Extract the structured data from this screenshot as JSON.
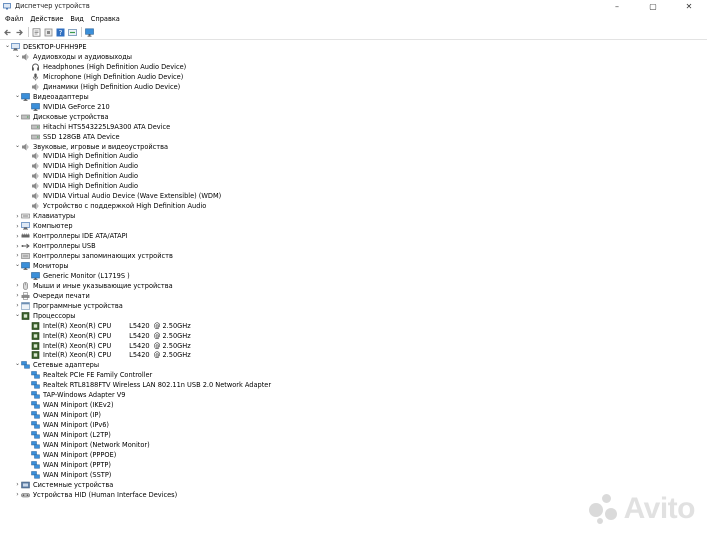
{
  "window": {
    "title": "Диспетчер устройств",
    "controls": [
      "–",
      "▢",
      "✕"
    ]
  },
  "menu": [
    "Файл",
    "Действие",
    "Вид",
    "Справка"
  ],
  "toolbar": [
    "back-icon",
    "forward-icon",
    "properties-icon",
    "update-driver-icon",
    "help-icon",
    "scan-icon",
    "monitor-icon"
  ],
  "tree": {
    "root": "DESKTOP-UFHH9PE",
    "audio": {
      "label": "Аудиовходы и аудиовыходы",
      "items": [
        "Headphones (High Definition Audio Device)",
        "Microphone (High Definition Audio Device)",
        "Динамики (High Definition Audio Device)"
      ]
    },
    "video": {
      "label": "Видеоадаптеры",
      "items": [
        "NVIDIA GeForce 210"
      ]
    },
    "disks": {
      "label": "Дисковые устройства",
      "items": [
        "Hitachi HTS543225L9A300 ATA Device",
        "SSD 128GB ATA Device"
      ]
    },
    "sound": {
      "label": "Звуковые, игровые и видеоустройства",
      "items": [
        "NVIDIA High Definition Audio",
        "NVIDIA High Definition Audio",
        "NVIDIA High Definition Audio",
        "NVIDIA High Definition Audio",
        "NVIDIA Virtual Audio Device (Wave Extensible) (WDM)",
        "Устройство с поддержкой High Definition Audio"
      ]
    },
    "keyboards": "Клавиатуры",
    "computer": "Компьютер",
    "ide": "Контроллеры IDE ATA/ATAPI",
    "usb": "Контроллеры USB",
    "storage": "Контроллеры запоминающих устройств",
    "monitors": {
      "label": "Мониторы",
      "items": [
        "Generic Monitor (L1719S )"
      ]
    },
    "mice": "Мыши и иные указывающие устройства",
    "print": "Очереди печати",
    "software": "Программные устройства",
    "cpu": {
      "label": "Процессоры",
      "items": [
        {
          "name": "Intel(R) Xeon(R) CPU",
          "spec": "L5420  @ 2.50GHz"
        },
        {
          "name": "Intel(R) Xeon(R) CPU",
          "spec": "L5420  @ 2.50GHz"
        },
        {
          "name": "Intel(R) Xeon(R) CPU",
          "spec": "L5420  @ 2.50GHz"
        },
        {
          "name": "Intel(R) Xeon(R) CPU",
          "spec": "L5420  @ 2.50GHz"
        }
      ]
    },
    "network": {
      "label": "Сетевые адаптеры",
      "items": [
        "Realtek PCIe FE Family Controller",
        "Realtek RTL8188FTV Wireless LAN 802.11n USB 2.0 Network Adapter",
        "TAP-Windows Adapter V9",
        "WAN Miniport (IKEv2)",
        "WAN Miniport (IP)",
        "WAN Miniport (IPv6)",
        "WAN Miniport (L2TP)",
        "WAN Miniport (Network Monitor)",
        "WAN Miniport (PPPOE)",
        "WAN Miniport (PPTP)",
        "WAN Miniport (SSTP)"
      ]
    },
    "system": "Системные устройства",
    "hid": "Устройства HID (Human Interface Devices)"
  },
  "watermark": "Avito",
  "colors": {
    "accent": "#2b6cb0",
    "monitor": "#3b8fd9",
    "cpu": "#3a5f2a"
  }
}
